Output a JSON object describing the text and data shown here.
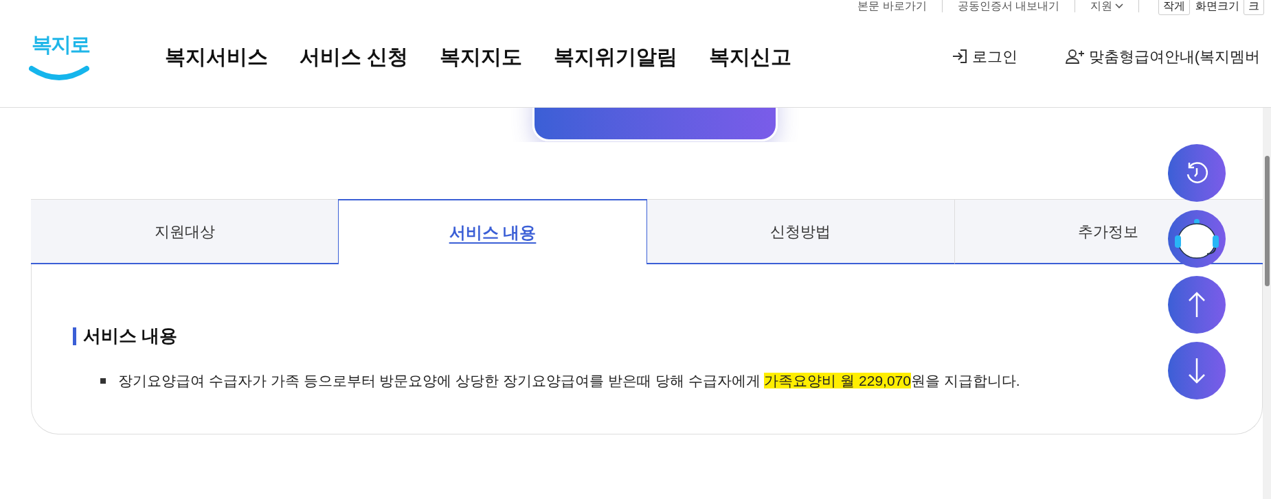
{
  "utility_links": [
    {
      "label": "본문 바로가기",
      "kind": "link"
    },
    {
      "label": "공동인증서 내보내기",
      "kind": "link"
    },
    {
      "label": "지원",
      "kind": "dropdown"
    },
    {
      "label": "작게",
      "kind": "boxed"
    },
    {
      "label": "화면크기",
      "kind": "text"
    },
    {
      "label": "크",
      "kind": "boxed"
    }
  ],
  "logo": {
    "text": "복지로"
  },
  "nav": [
    "복지서비스",
    "서비스 신청",
    "복지지도",
    "복지위기알림",
    "복지신고"
  ],
  "header_actions": [
    {
      "label": "로그인",
      "kind": "login"
    },
    {
      "label": "맞춤형급여안내(복지멤버",
      "kind": "member"
    }
  ],
  "tabs": [
    {
      "label": "지원대상",
      "selected": false
    },
    {
      "label": "서비스 내용",
      "selected": true
    },
    {
      "label": "신청방법",
      "selected": false
    },
    {
      "label": "추가정보",
      "selected": false
    }
  ],
  "section": {
    "title": "서비스 내용",
    "bullets": [
      {
        "before": "장기요양급여 수급자가 가족 등으로부터 방문요양에 상당한 장기요양급여를 받은때 당해 수급자에게 ",
        "highlight": "가족요양비 월 229,070",
        "after": "원을 지급합니다."
      }
    ]
  },
  "floating_buttons": [
    {
      "kind": "history"
    },
    {
      "kind": "chatbot"
    },
    {
      "kind": "top"
    },
    {
      "kind": "bottom"
    }
  ]
}
